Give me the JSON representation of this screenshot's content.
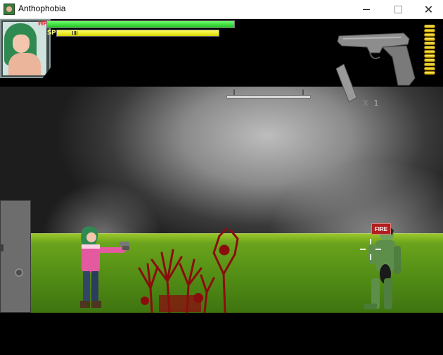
{
  "window": {
    "title": "Anthophobia",
    "minimize_glyph": "",
    "close_glyph": "✕"
  },
  "hud": {
    "hp_label": "HP",
    "sp_label": "SP",
    "hp_fraction": 1.0,
    "sp_fraction": 1.0,
    "magazine_prefix": "X",
    "magazine_count": "1",
    "bullets_in_clip": 12
  },
  "scene": {
    "sign_text": "FIRE"
  },
  "colors": {
    "hp": "#21c021",
    "sp": "#d9d900",
    "floor": "#5a961a",
    "blood": "#8a0d0d",
    "zombie": "#5d8f4a"
  }
}
